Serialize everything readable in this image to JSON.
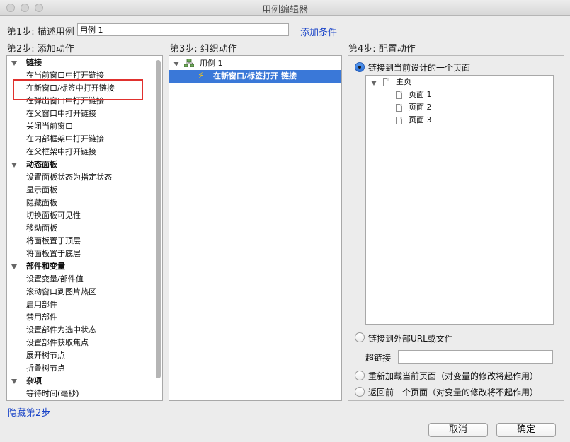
{
  "window": {
    "title": "用例编辑器"
  },
  "step1": {
    "label": "第1步: 描述用例",
    "value": "用例 1",
    "add_condition": "添加条件"
  },
  "step2": {
    "label": "第2步: 添加动作",
    "categories": [
      {
        "name": "链接",
        "items": [
          "在当前窗口中打开链接",
          "在新窗口/标签中打开链接",
          "在弹出窗口中打开链接",
          "在父窗口中打开链接",
          "关闭当前窗口",
          "在内部框架中打开链接",
          "在父框架中打开链接"
        ]
      },
      {
        "name": "动态面板",
        "items": [
          "设置面板状态为指定状态",
          "显示面板",
          "隐藏面板",
          "切换面板可见性",
          "移动面板",
          "将面板置于顶层",
          "将面板置于底层"
        ]
      },
      {
        "name": "部件和变量",
        "items": [
          "设置变量/部件值",
          "滚动窗口到图片热区",
          "启用部件",
          "禁用部件",
          "设置部件为选中状态",
          "设置部件获取焦点",
          "展开树节点",
          "折叠树节点"
        ]
      },
      {
        "name": "杂项",
        "items": [
          "等待时间(毫秒)"
        ]
      }
    ],
    "hide_link": "隐藏第2步"
  },
  "step3": {
    "label": "第3步: 组织动作",
    "case_name": "用例 1",
    "action": "在新窗口/标签打开 链接"
  },
  "step4": {
    "label": "第4步: 配置动作",
    "options": {
      "link_current": "链接到当前设计的一个页面",
      "link_external": "链接到外部URL或文件",
      "hyperlink_label": "超链接",
      "reload": "重新加载当前页面（对变量的修改将起作用）",
      "back": "返回前一个页面（对变量的修改将不起作用）"
    },
    "tree": {
      "root": "主页",
      "pages": [
        "页面 1",
        "页面 2",
        "页面 3"
      ]
    }
  },
  "buttons": {
    "cancel": "取消",
    "ok": "确定"
  }
}
